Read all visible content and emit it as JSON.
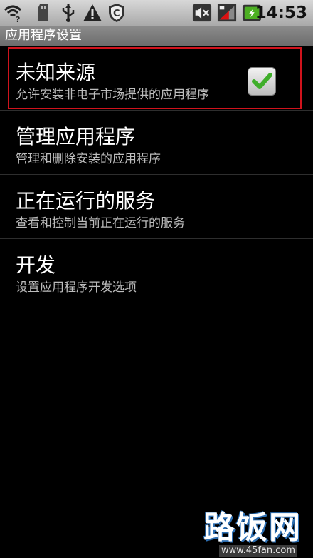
{
  "status_bar": {
    "time": "14:53",
    "icons": {
      "left": [
        "wifi-question-icon",
        "sd-card-icon",
        "usb-icon",
        "warning-icon",
        "shield-icon"
      ],
      "right": [
        "mute-icon",
        "signal-icon",
        "battery-charging-icon"
      ]
    }
  },
  "title_bar": {
    "title": "应用程序设置"
  },
  "preferences": [
    {
      "title": "未知来源",
      "summary": "允许安装非电子市场提供的应用程序",
      "checked": true
    },
    {
      "title": "管理应用程序",
      "summary": "管理和删除安装的应用程序"
    },
    {
      "title": "正在运行的服务",
      "summary": "查看和控制当前正在运行的服务"
    },
    {
      "title": "开发",
      "summary": "设置应用程序开发选项"
    }
  ],
  "watermark": {
    "logo": "路饭网",
    "url": "www.45fan.com"
  },
  "colors": {
    "highlight": "#d0131c",
    "check": "#3fae2a",
    "background": "#000000"
  }
}
